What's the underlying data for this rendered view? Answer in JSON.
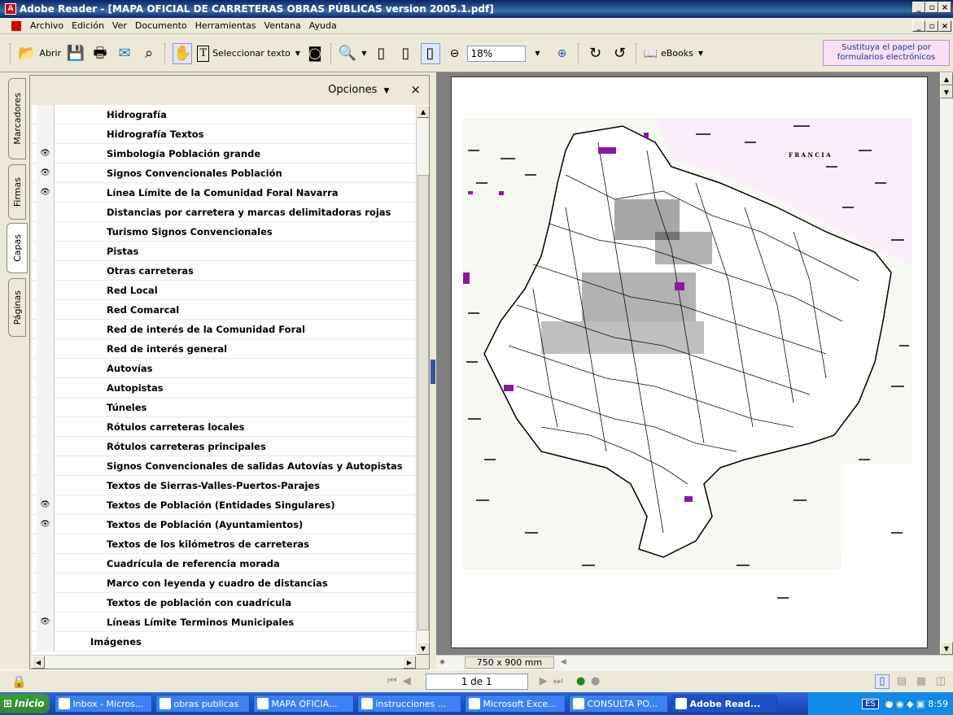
{
  "window": {
    "title": "Adobe Reader - [MAPA OFICIAL DE CARRETERAS OBRAS PÚBLICAS version 2005.1.pdf]"
  },
  "menu": [
    "Archivo",
    "Edición",
    "Ver",
    "Documento",
    "Herramientas",
    "Ventana",
    "Ayuda"
  ],
  "toolbar": {
    "open_label": "Abrir",
    "select_text_label": "Seleccionar texto",
    "zoom_value": "18%",
    "ebooks_label": "eBooks",
    "promo_line1": "Sustituya el papel por",
    "promo_line2": "formularios electrónicos"
  },
  "side_tabs": [
    "Marcadores",
    "Firmas",
    "Capas",
    "Páginas"
  ],
  "layers_panel": {
    "options_label": "Opciones",
    "close_glyph": "×",
    "layers": [
      {
        "label": "Hidrografía",
        "visible": false
      },
      {
        "label": "Hidrografía Textos",
        "visible": false
      },
      {
        "label": "Simbología Población grande",
        "visible": true
      },
      {
        "label": "Signos Convencionales Población",
        "visible": true
      },
      {
        "label": "Línea Límite de la Comunidad Foral Navarra",
        "visible": true
      },
      {
        "label": "Distancias por carretera y marcas delimitadoras rojas",
        "visible": false
      },
      {
        "label": "Turismo Signos Convencionales",
        "visible": false
      },
      {
        "label": "Pistas",
        "visible": false
      },
      {
        "label": "Otras carreteras",
        "visible": false
      },
      {
        "label": "Red Local",
        "visible": false
      },
      {
        "label": "Red Comarcal",
        "visible": false
      },
      {
        "label": "Red de interés de la Comunidad Foral",
        "visible": false
      },
      {
        "label": "Red de interés general",
        "visible": false
      },
      {
        "label": "Autovías",
        "visible": false
      },
      {
        "label": "Autopistas",
        "visible": false
      },
      {
        "label": "Túneles",
        "visible": false
      },
      {
        "label": "Rótulos carreteras locales",
        "visible": false
      },
      {
        "label": "Rótulos carreteras principales",
        "visible": false
      },
      {
        "label": "Signos Convencionales de salidas Autovías y Autopistas",
        "visible": false
      },
      {
        "label": "Textos de Sierras-Valles-Puertos-Parajes",
        "visible": false
      },
      {
        "label": "Textos de Población (Entidades Singulares)",
        "visible": true
      },
      {
        "label": "Textos de Población (Ayuntamientos)",
        "visible": true
      },
      {
        "label": "Textos de los kilómetros de carreteras",
        "visible": false
      },
      {
        "label": "Cuadrícula de referencia morada",
        "visible": false
      },
      {
        "label": "Marco con leyenda y cuadro de distancias",
        "visible": false
      },
      {
        "label": "Textos de población con cuadrícula",
        "visible": false
      },
      {
        "label": "Líneas Límite Terminos Municipales",
        "visible": true
      },
      {
        "label": "Imágenes",
        "visible": false,
        "group": true
      }
    ]
  },
  "document": {
    "page_size": "750 x 900 mm",
    "map_label_francia": "F R A N C I A"
  },
  "navigation": {
    "page_indicator": "1 de 1"
  },
  "taskbar": {
    "start_label": "Inicio",
    "tasks": [
      {
        "label": "Inbox - Micros...",
        "active": false
      },
      {
        "label": "obras publicas",
        "active": false
      },
      {
        "label": "MAPA OFICIA...",
        "active": false
      },
      {
        "label": "instrucciones ...",
        "active": false
      },
      {
        "label": "Microsoft Exce...",
        "active": false
      },
      {
        "label": "CONSULTA PO...",
        "active": false
      },
      {
        "label": "Adobe Read...",
        "active": true
      }
    ],
    "language": "ES",
    "clock": "8:59"
  }
}
